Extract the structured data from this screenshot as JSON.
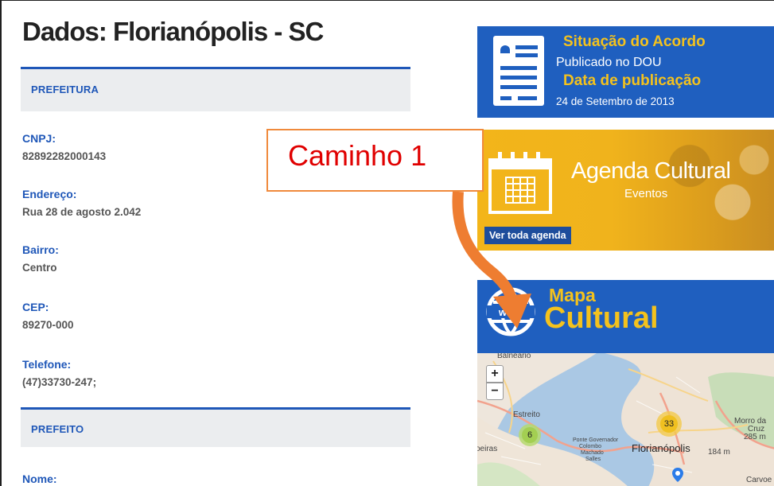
{
  "title": "Dados: Florianópolis - SC",
  "sections": {
    "prefeitura": "PREFEITURA",
    "prefeito": "PREFEITO"
  },
  "fields": [
    {
      "label": "CNPJ:",
      "value": "82892282000143"
    },
    {
      "label": "Endereço:",
      "value": "Rua 28 de agosto 2.042"
    },
    {
      "label": "Bairro:",
      "value": "Centro"
    },
    {
      "label": "CEP:",
      "value": "89270-000"
    },
    {
      "label": "Telefone:",
      "value": "(47)33730-247;"
    },
    {
      "label": "Nome:",
      "value": ""
    }
  ],
  "acordo": {
    "title": "Situação do Acordo",
    "status": "Publicado no DOU",
    "date_label": "Data de publicação",
    "date": "24 de Setembro de 2013"
  },
  "agenda": {
    "title": "Agenda Cultural",
    "subtitle": "Eventos",
    "button": "Ver toda agenda"
  },
  "mapa": {
    "line1": "Mapa",
    "line2": "Cultural",
    "zoom_in": "+",
    "zoom_out": "−",
    "labels": {
      "balneario": "Balneário",
      "estreito": "Estreito",
      "ponte": "Ponte Governador",
      "colombo": "Colombo",
      "machado": "Machado",
      "salles": "Salles",
      "florianopolis": "Florianópolis",
      "morro1": "Morro da",
      "morro2": "Cruz",
      "morro3": "285 m",
      "elev": "184 m",
      "carvo": "Carvoe",
      "oeiras": "oeiras"
    },
    "clusters": {
      "c6": "6",
      "c33": "33"
    }
  },
  "annotation": {
    "label": "Caminho 1"
  },
  "colors": {
    "brand_blue": "#1f5fbf",
    "accent_yellow": "#f4c21d",
    "annotation_red": "#e00000",
    "arrow_orange": "#ee7d31"
  }
}
